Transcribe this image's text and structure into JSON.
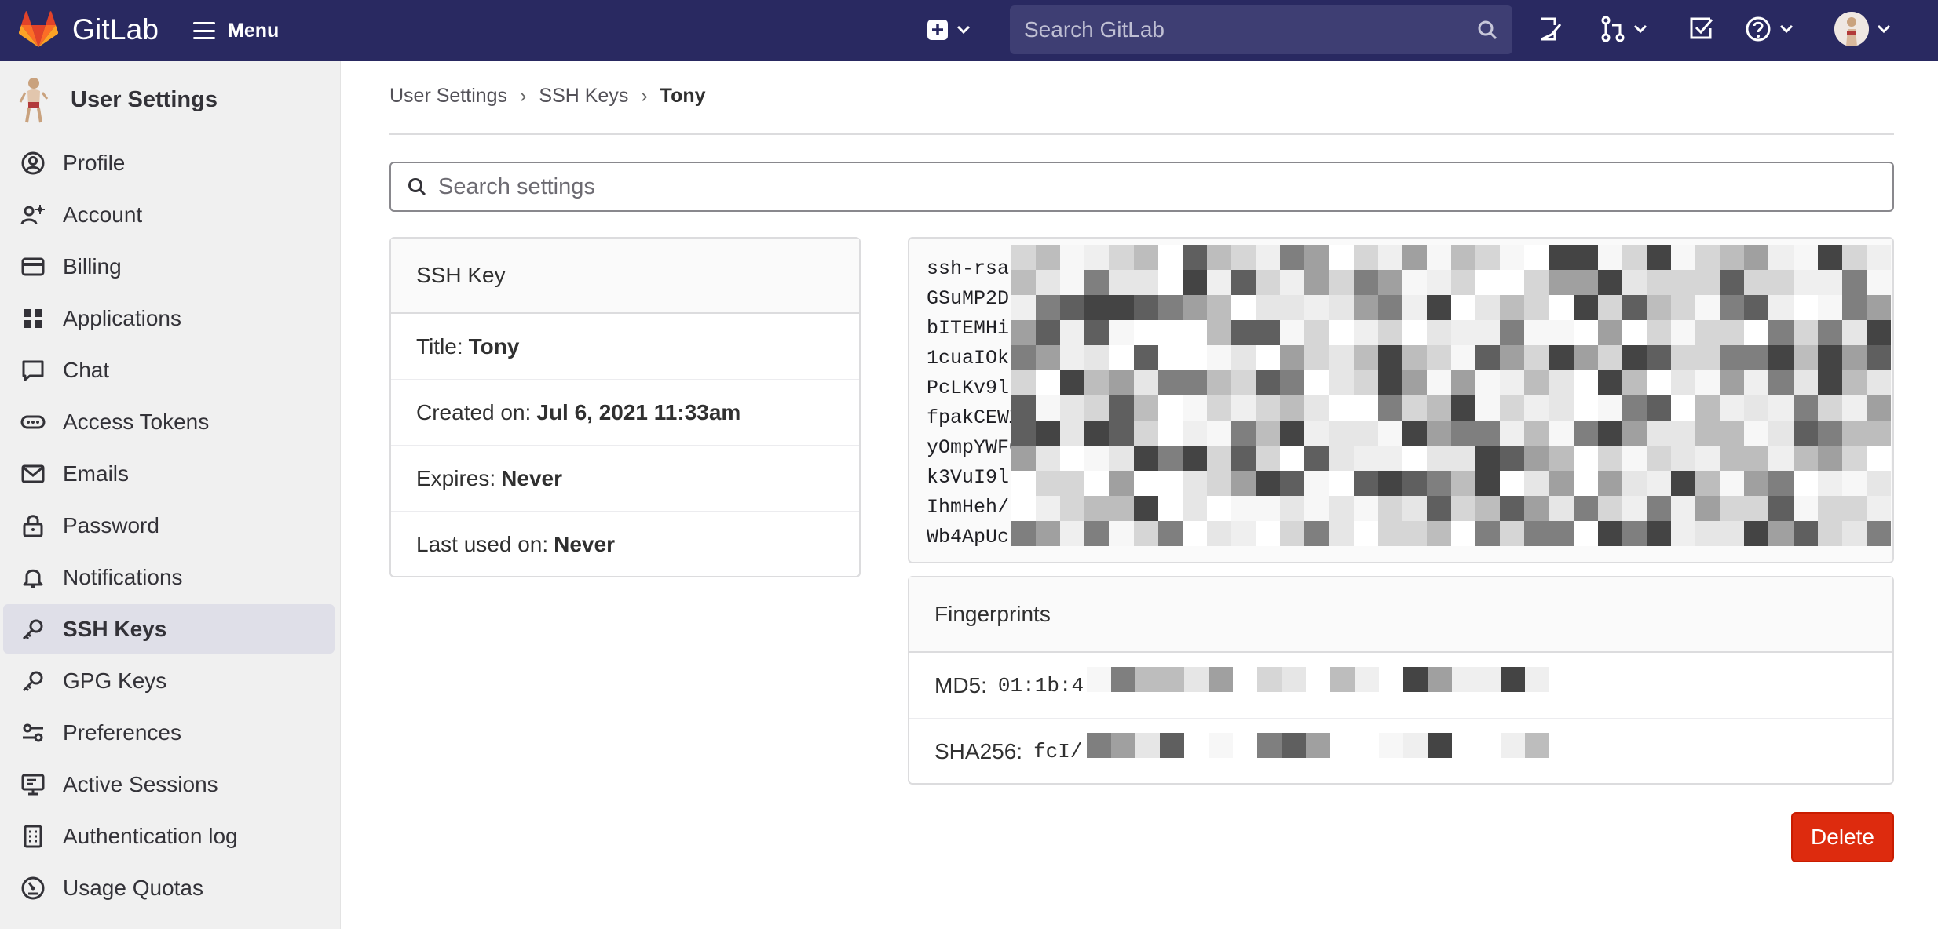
{
  "topbar": {
    "brand": "GitLab",
    "menu_label": "Menu",
    "search_placeholder": "Search GitLab"
  },
  "sidebar": {
    "title": "User Settings",
    "items": [
      {
        "label": "Profile",
        "icon": "profile-icon"
      },
      {
        "label": "Account",
        "icon": "account-icon"
      },
      {
        "label": "Billing",
        "icon": "billing-icon"
      },
      {
        "label": "Applications",
        "icon": "applications-icon"
      },
      {
        "label": "Chat",
        "icon": "chat-icon"
      },
      {
        "label": "Access Tokens",
        "icon": "token-icon"
      },
      {
        "label": "Emails",
        "icon": "mail-icon"
      },
      {
        "label": "Password",
        "icon": "lock-icon"
      },
      {
        "label": "Notifications",
        "icon": "bell-icon"
      },
      {
        "label": "SSH Keys",
        "icon": "key-icon",
        "active": true
      },
      {
        "label": "GPG Keys",
        "icon": "key-icon"
      },
      {
        "label": "Preferences",
        "icon": "preferences-icon"
      },
      {
        "label": "Active Sessions",
        "icon": "monitor-icon"
      },
      {
        "label": "Authentication log",
        "icon": "log-icon"
      },
      {
        "label": "Usage Quotas",
        "icon": "quota-icon"
      }
    ]
  },
  "breadcrumb": [
    "User Settings",
    "SSH Keys",
    "Tony"
  ],
  "settings_search_placeholder": "Search settings",
  "key_info": {
    "heading": "SSH Key",
    "title_label": "Title:",
    "title_value": "Tony",
    "created_label": "Created on:",
    "created_value": "Jul 6, 2021 11:33am",
    "expires_label": "Expires:",
    "expires_value": "Never",
    "last_used_label": "Last used on:",
    "last_used_value": "Never"
  },
  "key_text_lines": [
    "ssh-rsa",
    "GSuMP2D",
    "bITEMHi",
    "1cuaIOk",
    "PcLKv9lL",
    "fpakCEWZ",
    "yOmpYWFG",
    "k3VuI9l",
    "IhmHeh/",
    "Wb4ApUc"
  ],
  "fingerprints": {
    "heading": "Fingerprints",
    "md5_label": "MD5:",
    "md5_value": "01:1b:4",
    "sha_label": "SHA256:",
    "sha_value": "fcI/"
  },
  "delete_label": "Delete",
  "colors": {
    "topbar": "#292961",
    "delete": "#dd2b0e",
    "sidebar_bg": "#f0f0f0",
    "active_item": "#dfdfe8"
  }
}
